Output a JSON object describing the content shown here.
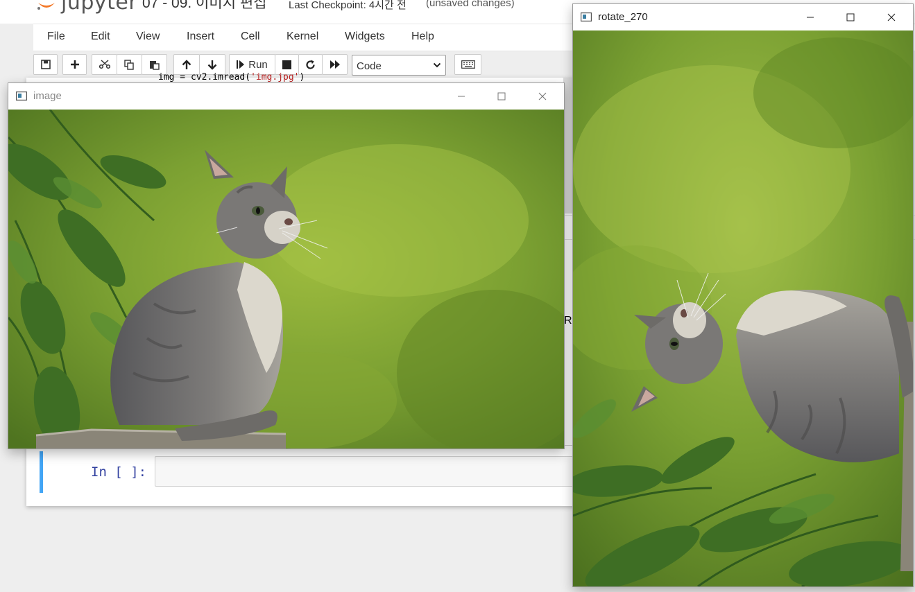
{
  "jupyter": {
    "logo_word": "jupyter",
    "notebook_name": "07 - 09. 이미지 편집",
    "checkpoint": "Last Checkpoint: 4시간 전",
    "unsaved": "(unsaved changes)",
    "menu": [
      "File",
      "Edit",
      "View",
      "Insert",
      "Cell",
      "Kernel",
      "Widgets",
      "Help"
    ],
    "toolbar": {
      "icons": [
        "save-icon",
        "plus-icon",
        "scissors-icon",
        "copy-icon",
        "paste-icon",
        "arrow-up-icon",
        "arrow-down-icon",
        "step-play-icon",
        "stop-icon",
        "restart-icon",
        "fast-forward-icon",
        "keyboard-icon"
      ],
      "run_label": "Run",
      "cell_type": "Code"
    },
    "code_fragment": {
      "left": "img = cv2.imread(",
      "str": "'img.jpg'",
      "right": ")"
    },
    "cell_prompt": "In [ ]:",
    "partial_char": "R"
  },
  "windows": {
    "image": {
      "title": "image",
      "icons": [
        "opencv-window-icon",
        "minimize-icon",
        "maximize-icon",
        "close-icon"
      ]
    },
    "rotate": {
      "title": "rotate_270",
      "icons": [
        "opencv-window-icon",
        "minimize-icon",
        "maximize-icon",
        "close-icon"
      ]
    }
  },
  "colors": {
    "jupyter_orange": "#f37726",
    "cell_selected_bar": "#42a5f5",
    "prompt_blue": "#303f9f",
    "photo_green": "#7ba032",
    "kitten_gray": "#6e6c6a"
  }
}
